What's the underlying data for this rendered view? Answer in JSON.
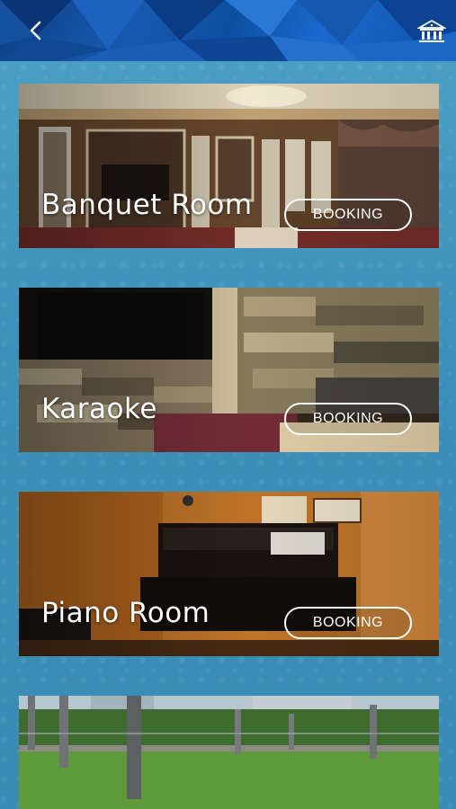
{
  "header": {
    "back_icon": "chevron-left-icon",
    "home_icon": "building-icon",
    "colors": {
      "primary": "#0d3f86",
      "accent": "#1a6ad0"
    }
  },
  "facilities": [
    {
      "title": "Banquet Room",
      "button": "BOOKING",
      "image": "banquet-room-photo"
    },
    {
      "title": "Karaoke",
      "button": "BOOKING",
      "image": "karaoke-room-photo"
    },
    {
      "title": "Piano Room",
      "button": "BOOKING",
      "image": "piano-room-photo"
    },
    {
      "title": "",
      "button": "",
      "image": "rooftop-garden-photo"
    }
  ]
}
